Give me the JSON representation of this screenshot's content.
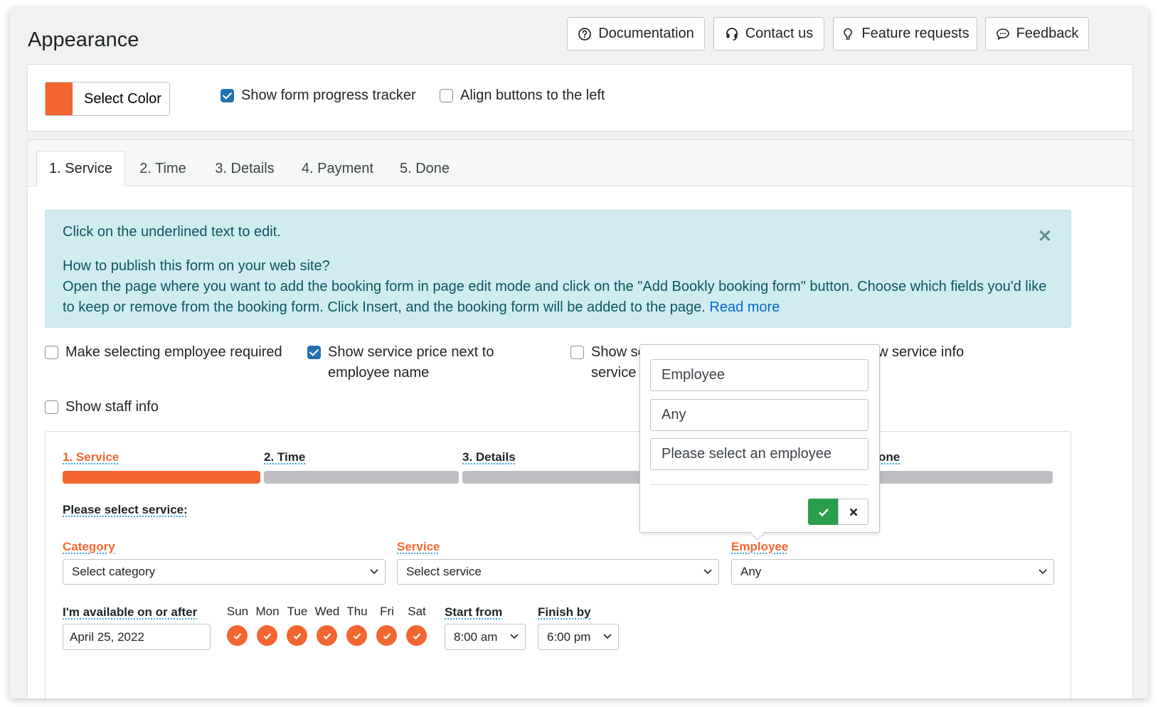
{
  "header": {
    "title": "Appearance",
    "buttons": {
      "documentation": "Documentation",
      "contact": "Contact us",
      "feature_requests": "Feature requests",
      "feedback": "Feedback"
    }
  },
  "settings": {
    "select_color_label": "Select Color",
    "accent_color": "#f4662f",
    "show_progress_tracker": "Show form progress tracker",
    "align_buttons_left": "Align buttons to the left"
  },
  "tabs": [
    "1. Service",
    "2. Time",
    "3. Details",
    "4. Payment",
    "5. Done"
  ],
  "notice": {
    "line1": "Click on the underlined text to edit.",
    "line2": "How to publish this form on your web site?",
    "line3": "Open the page where you want to add the booking form in page edit mode and click on the \"Add Bookly booking form\" button. Choose which fields you'd like to keep or remove from the booking form. Click Insert, and the booking form will be added to the page.",
    "link": "Read more"
  },
  "options": {
    "employee_required": "Make selecting employee required",
    "price_next_line1": "Show service price next to",
    "price_next_line2": "employee name",
    "show_se_line1": "Show se",
    "show_se_line2": "service",
    "service_info": "w service info",
    "staff_info": "Show staff info"
  },
  "booking": {
    "steps": [
      "1. Service",
      "2. Time",
      "3. Details",
      "one"
    ],
    "please_select": "Please select service:",
    "category_label": "Category",
    "category_value": "Select category",
    "service_label": "Service",
    "service_value": "Select service",
    "employee_label": "Employee",
    "employee_value": "Any",
    "available_label": "I'm available on or after",
    "date_value": "April 25, 2022",
    "days": [
      "Sun",
      "Mon",
      "Tue",
      "Wed",
      "Thu",
      "Fri",
      "Sat"
    ],
    "start_label": "Start from",
    "start_value": "8:00 am",
    "finish_label": "Finish by",
    "finish_value": "6:00 pm"
  },
  "popover": {
    "field1": "Employee",
    "field2": "Any",
    "field3": "Please select an employee"
  }
}
